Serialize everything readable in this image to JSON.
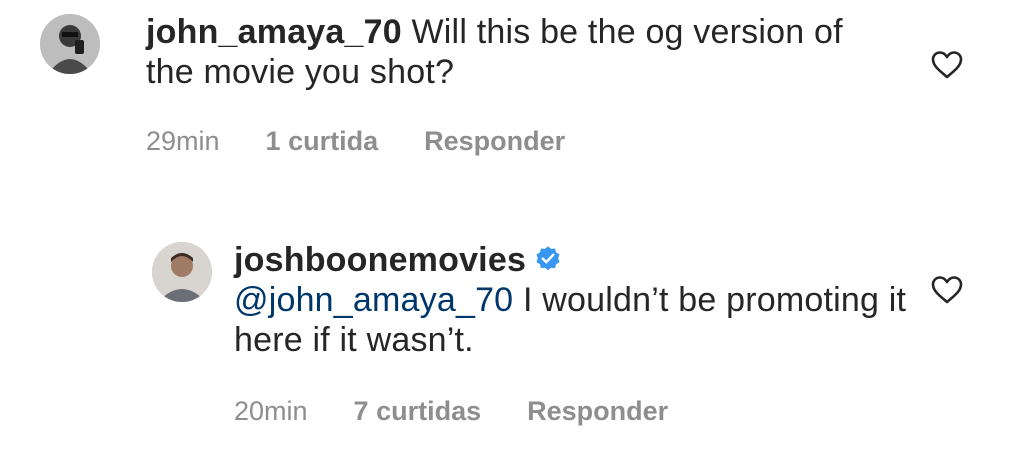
{
  "comments": [
    {
      "username": "john_amaya_70",
      "text": "Will this be the og version of the movie you shot?",
      "time": "29min",
      "likes": "1 curtida",
      "reply_label": "Responder",
      "verified": false
    },
    {
      "username": "joshboonemovies",
      "mention": "@john_amaya_70",
      "text": "I wouldn’t be promoting it here if it wasn’t.",
      "time": "20min",
      "likes": "7 curtidas",
      "reply_label": "Responder",
      "verified": true
    }
  ],
  "icons": {
    "like": "heart-outline-icon",
    "verified": "verified-badge-icon"
  },
  "colors": {
    "verified_badge": "#3897f0",
    "mention": "#00376b",
    "meta_text": "#8e8e8e"
  }
}
